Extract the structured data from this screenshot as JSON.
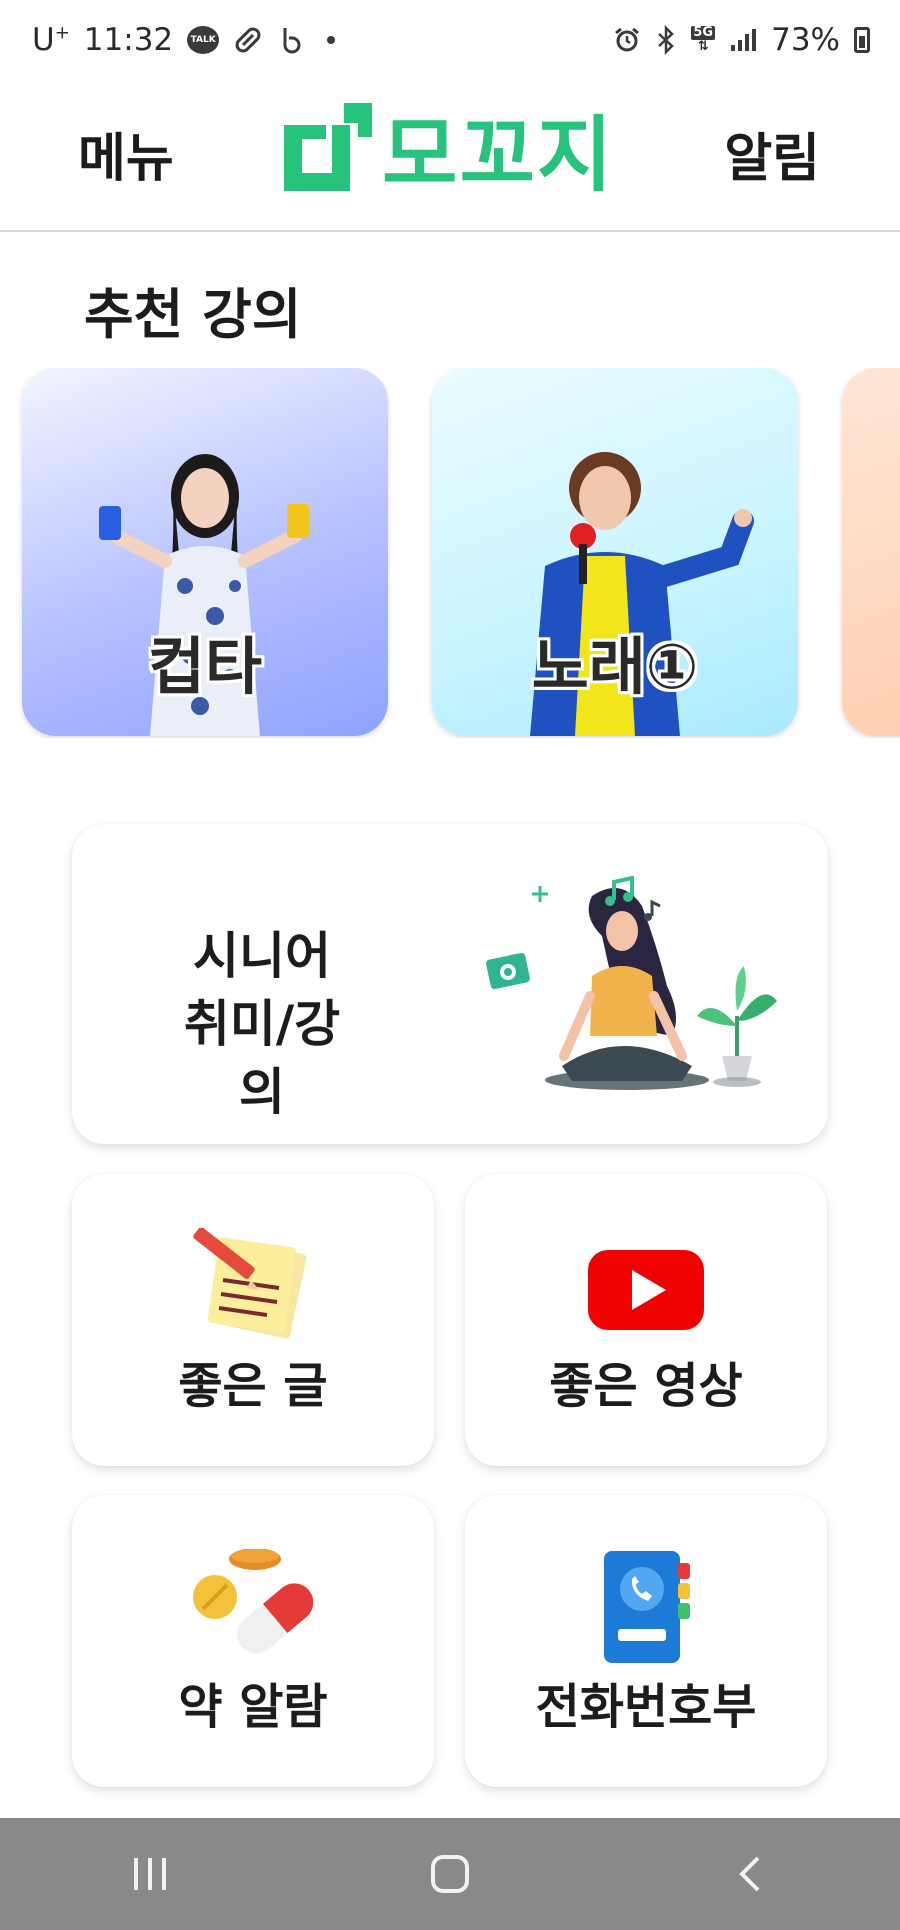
{
  "status_bar": {
    "carrier": "U",
    "carrier_sup": "+",
    "time": "11:32",
    "talk_badge": "TALK",
    "network": "5G",
    "battery": "73%"
  },
  "header": {
    "menu_label": "메뉴",
    "app_name": "모꼬지",
    "alarm_label": "알림",
    "brand_color": "#27c27b"
  },
  "recommended": {
    "title": "추천 강의",
    "lectures": [
      {
        "label": "컵타"
      },
      {
        "label": "노래①"
      },
      {
        "label": ""
      }
    ]
  },
  "menu_cards": {
    "hobby": {
      "line1": "시니어",
      "line2": "취미/강의"
    },
    "good_text": {
      "label": "좋은 글",
      "icon": "memo-pencil-icon"
    },
    "good_video": {
      "label": "좋은 영상",
      "icon": "youtube-play-icon"
    },
    "medicine": {
      "label": "약 알람",
      "icon": "pills-icon"
    },
    "phonebook": {
      "label": "전화번호부",
      "icon": "phonebook-icon"
    }
  },
  "nav": {
    "recent": "recent-apps-icon",
    "home": "home-icon",
    "back": "back-icon"
  }
}
